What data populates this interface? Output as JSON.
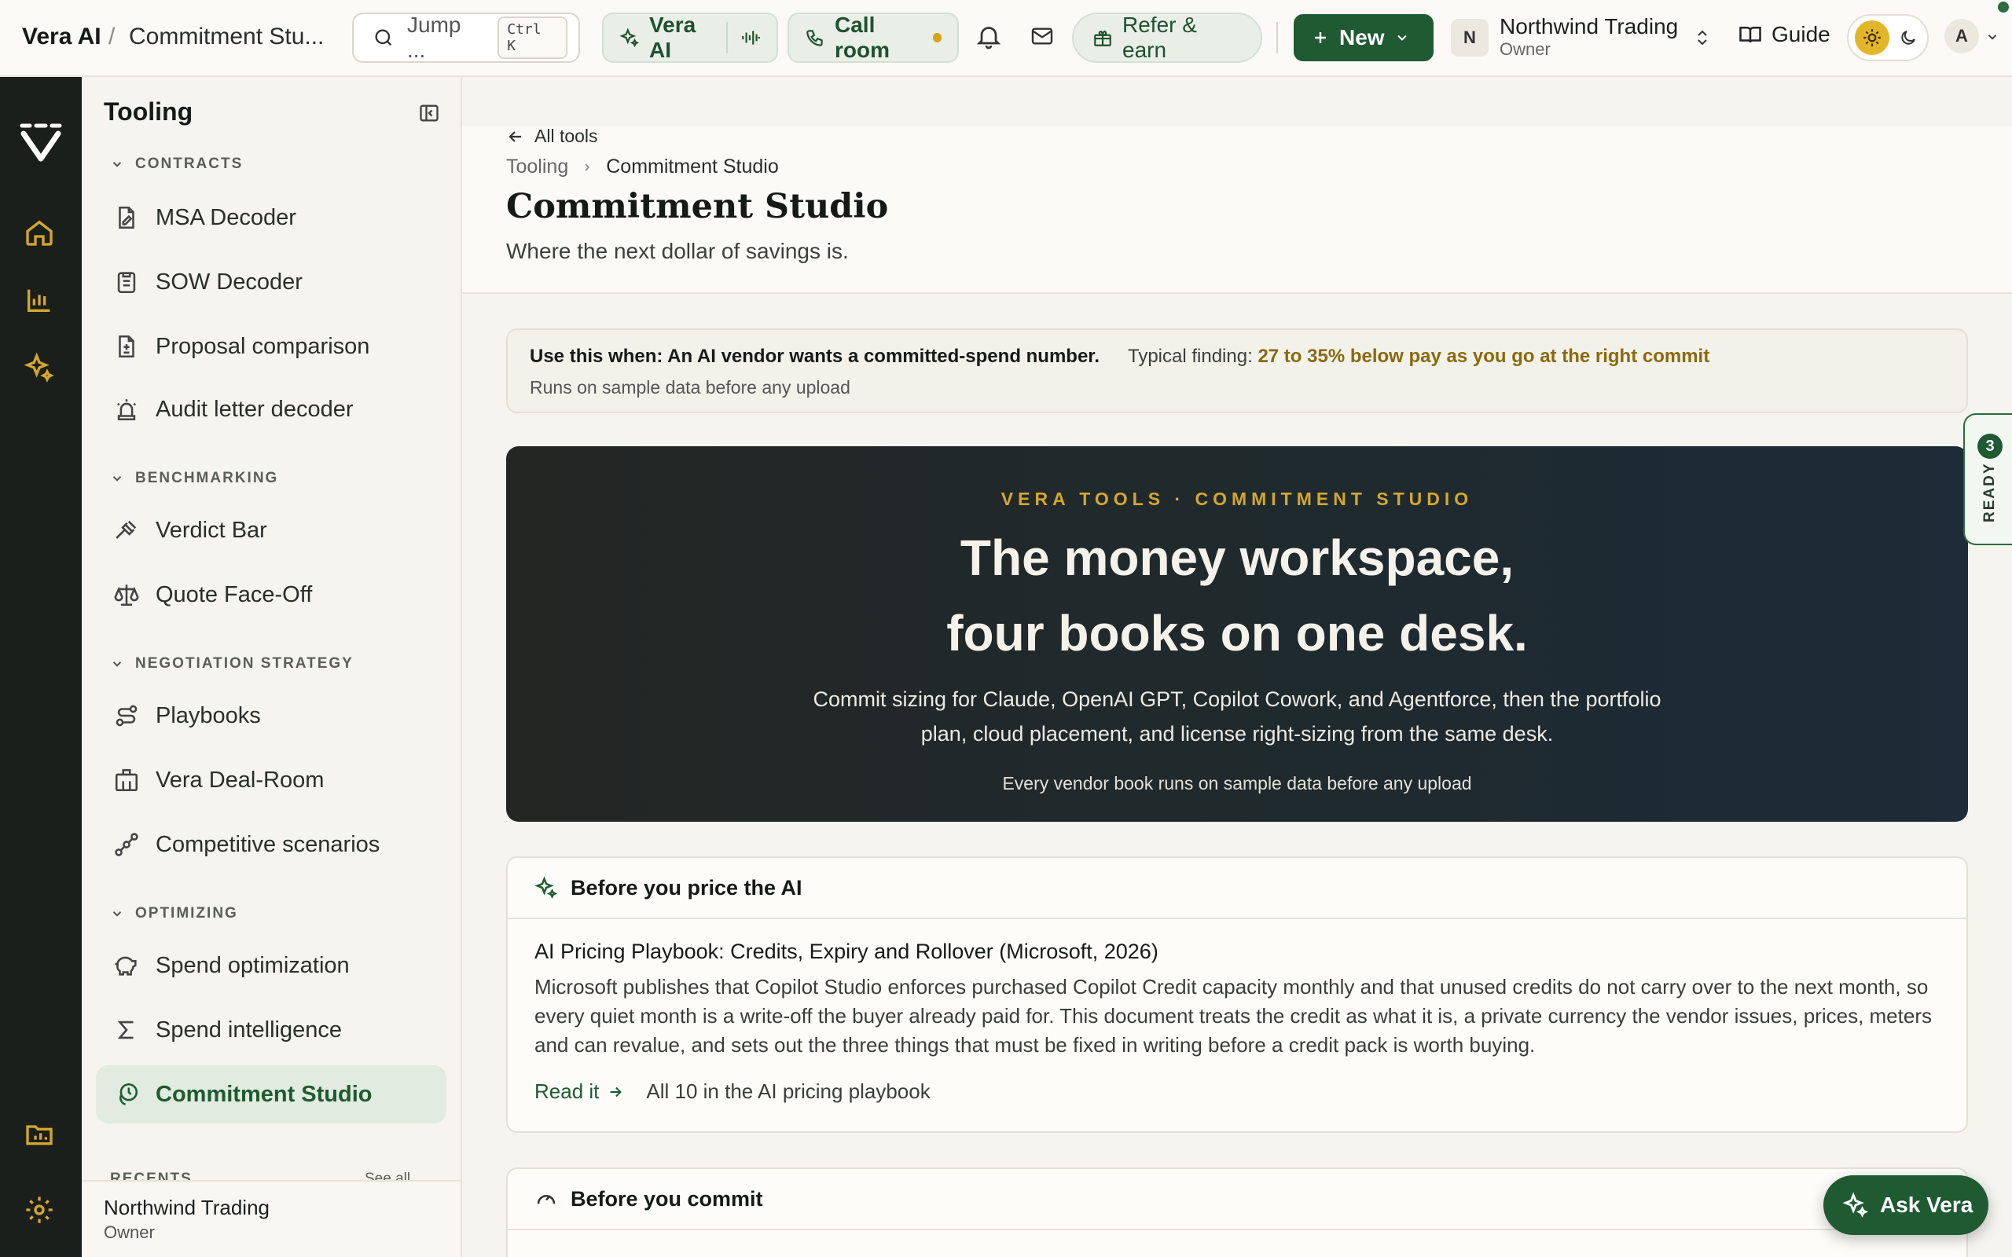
{
  "topbar": {
    "app_name": "Vera AI",
    "crumb_sep": "/",
    "page_name": "Commitment Stu...",
    "search_placeholder": "Jump ...",
    "search_kbd": "Ctrl K",
    "vera_pill": "Vera AI",
    "call_room": "Call room",
    "refer": "Refer & earn",
    "new_button": "New",
    "org_initial": "N",
    "org_name": "Northwind Trading",
    "org_role": "Owner",
    "guide": "Guide",
    "user_initial": "A"
  },
  "sidebar": {
    "title": "Tooling",
    "sections": [
      {
        "label": "CONTRACTS",
        "items": [
          "MSA Decoder",
          "SOW Decoder",
          "Proposal comparison",
          "Audit letter decoder"
        ]
      },
      {
        "label": "BENCHMARKING",
        "items": [
          "Verdict Bar",
          "Quote Face-Off"
        ]
      },
      {
        "label": "NEGOTIATION STRATEGY",
        "items": [
          "Playbooks",
          "Vera Deal-Room",
          "Competitive scenarios"
        ]
      },
      {
        "label": "OPTIMIZING",
        "items": [
          "Spend optimization",
          "Spend intelligence",
          "Commitment Studio"
        ]
      }
    ],
    "recents_label": "RECENTS",
    "see_all": "See all",
    "footer_name": "Northwind Trading",
    "footer_role": "Owner"
  },
  "header": {
    "back_label": "All tools",
    "breadcrumb_parent": "Tooling",
    "breadcrumb_current": "Commitment Studio",
    "title": "Commitment Studio",
    "subtitle": "Where the next dollar of savings is."
  },
  "hint": {
    "when": "Use this when: An AI vendor wants a committed-spend number.",
    "finding_label": "Typical finding:",
    "finding_value": "27 to 35% below pay as you go at the right commit",
    "note": "Runs on sample data before any upload"
  },
  "hero": {
    "eyebrow": "VERA TOOLS · COMMITMENT STUDIO",
    "line1": "The money workspace,",
    "line2": "four books on one desk.",
    "paragraph": "Commit sizing for Claude, OpenAI GPT, Copilot Cowork, and Agentforce, then the portfolio plan, cloud placement, and license right-sizing from the same desk.",
    "note": "Every vendor book runs on sample data before any upload"
  },
  "card1": {
    "heading": "Before you price the AI",
    "doc_title": "AI Pricing Playbook: Credits, Expiry and Rollover (Microsoft, 2026)",
    "doc_body": "Microsoft publishes that Copilot Studio enforces purchased Copilot Credit capacity monthly and that unused credits do not carry over to the next month, so every quiet month is a write-off the buyer already paid for. This document treats the credit as what it is, a private currency the vendor issues, prices, meters and can revalue, and sets out the three things that must be fixed in writing before a credit pack is worth buying.",
    "read_link": "Read it",
    "all_link": "All 10 in the AI pricing playbook"
  },
  "card2": {
    "heading": "Before you commit"
  },
  "ready_tab": {
    "count": "3",
    "label": "READY"
  },
  "ask_button": "Ask Vera",
  "colors": {
    "brand": "#1f5a32",
    "accent": "#d4a72c",
    "rail": "#1b1f1b"
  }
}
